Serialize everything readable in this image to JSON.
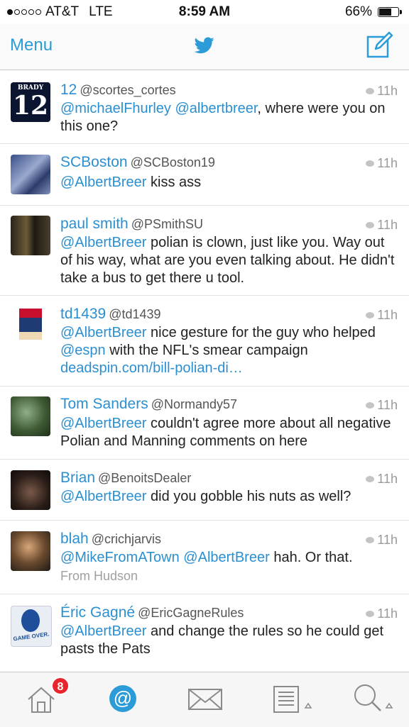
{
  "status": {
    "carrier": "AT&T",
    "network": "LTE",
    "time": "8:59 AM",
    "battery": "66%",
    "battery_level": 0.66,
    "signal_bars": 1
  },
  "nav": {
    "menu_label": "Menu",
    "logo_icon": "twitter-bird-icon",
    "compose_icon": "compose-icon"
  },
  "colors": {
    "accent": "#2b8fd0",
    "badge": "#e8252c"
  },
  "tweets": [
    {
      "name": "12",
      "handle": "@scortes_cortes",
      "time": "11h",
      "p1": "@michaelFhurley",
      "p2": " ",
      "p3": "@albertbreer",
      "p4": ", where were you on this one?",
      "p5": "",
      "p6": "",
      "from": ""
    },
    {
      "name": "SCBoston",
      "handle": "@SCBoston19",
      "time": "11h",
      "p1": "@AlbertBreer",
      "p2": " kiss ass",
      "p3": "",
      "p4": "",
      "p5": "",
      "p6": "",
      "from": ""
    },
    {
      "name": "paul smith",
      "handle": "@PSmithSU",
      "time": "11h",
      "p1": "@AlbertBreer",
      "p2": " polian is clown, just like you. Way out of his way, what are you even talking about. He didn't take a bus to get there u tool.",
      "p3": "",
      "p4": "",
      "p5": "",
      "p6": "",
      "from": ""
    },
    {
      "name": "td1439",
      "handle": "@td1439",
      "time": "11h",
      "p1": "@AlbertBreer",
      "p2": " nice gesture for the guy who helped ",
      "p3": "@espn",
      "p4": " with the NFL's smear campaign ",
      "p5": "deadspin.com/bill-polian-di…",
      "p6": "",
      "from": ""
    },
    {
      "name": "Tom Sanders",
      "handle": "@Normandy57",
      "time": "11h",
      "p1": "@AlbertBreer",
      "p2": " couldn't agree more about all negative Polian and Manning comments on here",
      "p3": "",
      "p4": "",
      "p5": "",
      "p6": "",
      "from": ""
    },
    {
      "name": "Brian",
      "handle": "@BenoitsDealer",
      "time": "11h",
      "p1": "@AlbertBreer",
      "p2": " did you gobble his nuts as well?",
      "p3": "",
      "p4": "",
      "p5": "",
      "p6": "",
      "from": ""
    },
    {
      "name": "blah",
      "handle": "@crichjarvis",
      "time": "11h",
      "p1": "@MikeFromATown",
      "p2": " ",
      "p3": "@AlbertBreer",
      "p4": " hah. Or that.",
      "p5": "",
      "p6": "",
      "from": "From Hudson"
    },
    {
      "name": "Éric Gagné",
      "handle": "@EricGagneRules",
      "time": "11h",
      "p1": "@AlbertBreer",
      "p2": " and change the rules so he could get pasts the Pats",
      "p3": "",
      "p4": "",
      "p5": "",
      "p6": "",
      "from": ""
    }
  ],
  "avatars": {
    "a0": "BRADY",
    "a0_num": "12",
    "a7": "GAME OVER."
  },
  "tabbar": {
    "home_badge": "8",
    "icons": [
      "home-icon",
      "mentions-icon",
      "messages-icon",
      "lists-icon",
      "search-icon"
    ]
  }
}
